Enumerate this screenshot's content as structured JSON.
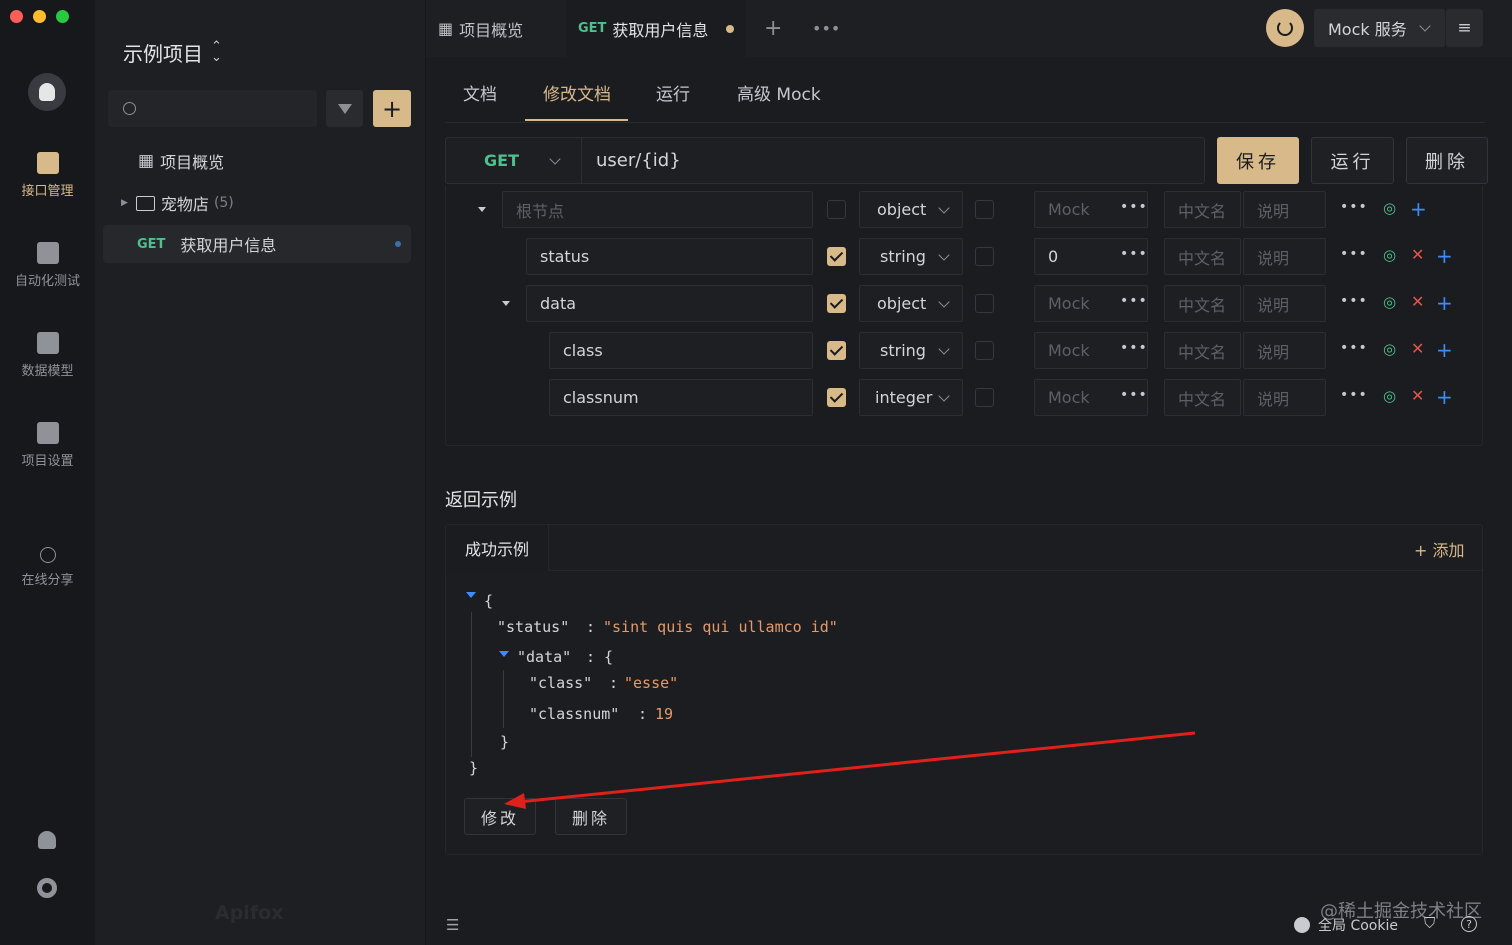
{
  "titlebar": {
    "tab_overview": "项目概览",
    "tab_active_method": "GET",
    "tab_active_label": "获取用户信息",
    "mock_service": "Mock 服务"
  },
  "rail": {
    "items": [
      {
        "label": "接口管理"
      },
      {
        "label": "自动化测试"
      },
      {
        "label": "数据模型"
      },
      {
        "label": "项目设置"
      },
      {
        "label": "在线分享"
      }
    ],
    "watermark": "Apifox"
  },
  "sidebar": {
    "project_title": "示例项目",
    "search_placeholder": "",
    "tree": {
      "overview": "项目概览",
      "folder": "宠物店",
      "folder_count": "(5)",
      "api_method": "GET",
      "api_name": "获取用户信息"
    }
  },
  "main": {
    "subtabs": [
      "文档",
      "修改文档",
      "运行",
      "高级 Mock"
    ],
    "request": {
      "method": "GET",
      "path": "user/{id}",
      "save": "保存",
      "run": "运行",
      "delete": "删除"
    },
    "schema": {
      "placeholders": {
        "root": "根节点",
        "mock": "Mock",
        "cn_name": "中文名",
        "desc": "说明"
      },
      "rows": [
        {
          "name": "",
          "type": "object",
          "mock": ""
        },
        {
          "name": "status",
          "type": "string",
          "mock": "0"
        },
        {
          "name": "data",
          "type": "object",
          "mock": ""
        },
        {
          "name": "class",
          "type": "string",
          "mock": ""
        },
        {
          "name": "classnum",
          "type": "integer",
          "mock": ""
        }
      ]
    },
    "response": {
      "section_title": "返回示例",
      "tab_label": "成功示例",
      "add_label": "+ 添加",
      "json": {
        "status_key": "\"status\"",
        "status_val": "\"sint quis qui ullamco id\"",
        "data_key": "\"data\"",
        "class_key": "\"class\"",
        "class_val": "\"esse\"",
        "classnum_key": "\"classnum\"",
        "classnum_val": "19"
      },
      "edit": "修改",
      "delete": "删除"
    },
    "footer": {
      "cookie": "全局 Cookie",
      "watermark": "@稀土掘金技术社区"
    }
  },
  "colors": {
    "accent": "#d8b98a",
    "method_get": "#4fc08d",
    "string_value": "#e59a6a",
    "arrow": "#e0201b"
  }
}
